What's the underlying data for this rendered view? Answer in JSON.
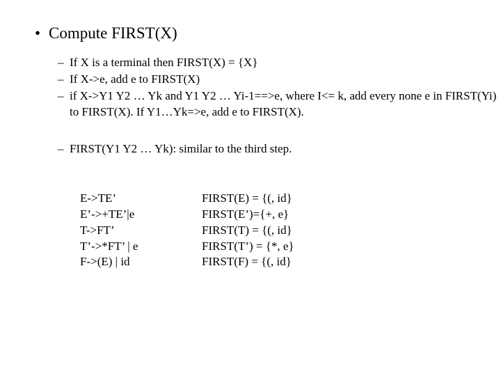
{
  "heading": "Compute FIRST(X)",
  "rules": [
    "If X is a terminal then FIRST(X) = {X}",
    "If X->e, add e to FIRST(X)",
    "if X->Y1 Y2 … Yk and Y1 Y2 … Yi-1==>e, where I<= k, add every none e in FIRST(Yi) to FIRST(X). If Y1…Yk=>e, add e to FIRST(X)."
  ],
  "rule_extra": "FIRST(Y1 Y2 … Yk): similar to the third step.",
  "grammar": [
    "E->TE’",
    "E’->+TE’|e",
    "T->FT’",
    "T’->*FT’ | e",
    "F->(E) | id"
  ],
  "firsts": [
    " FIRST(E) = {(, id}",
    "FIRST(E’)={+, e}",
    " FIRST(T) = {(, id}",
    " FIRST(T’) = {*, e}",
    " FIRST(F) = {(, id}"
  ]
}
